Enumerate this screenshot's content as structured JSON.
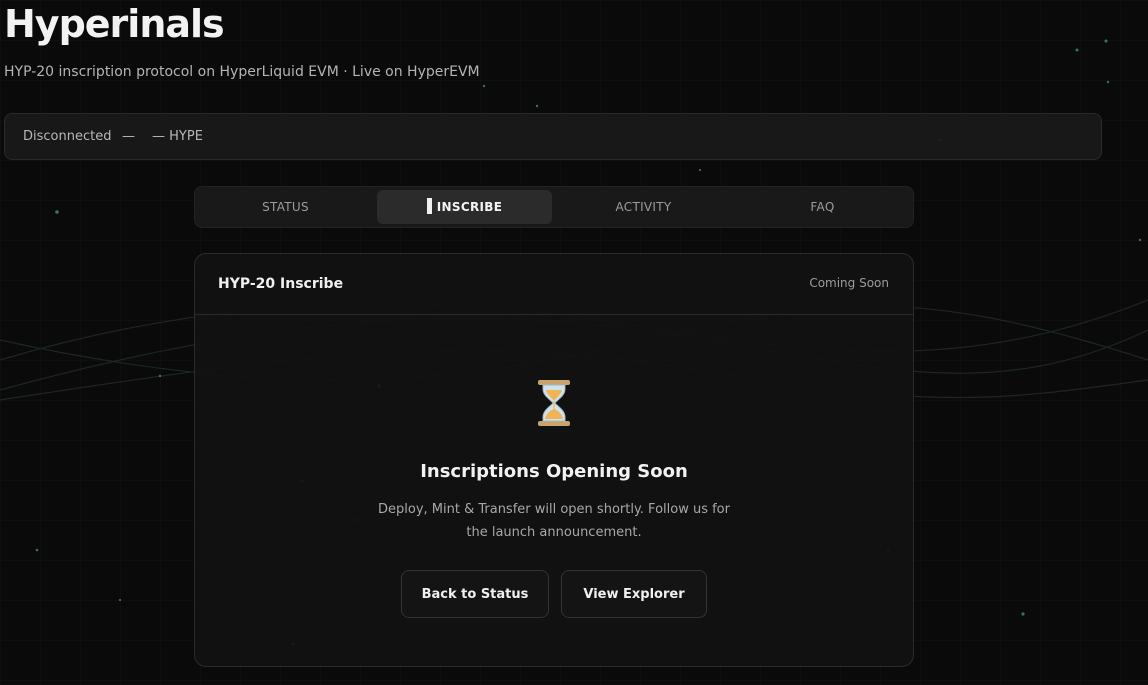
{
  "app": {
    "title": "Hyperinals",
    "subtitle": "HYP-20 inscription protocol on HyperLiquid EVM · Live on HyperEVM"
  },
  "wallet": {
    "status": "Disconnected",
    "address": "—",
    "balance": "— HYPE"
  },
  "tabs": [
    {
      "label": "STATUS",
      "active": false
    },
    {
      "label": "INSCRIBE",
      "active": true
    },
    {
      "label": "ACTIVITY",
      "active": false
    },
    {
      "label": "FAQ",
      "active": false
    }
  ],
  "panel": {
    "title": "HYP-20 Inscribe",
    "badge": "Coming Soon",
    "icon": "hourglass-icon",
    "heading": "Inscriptions Opening Soon",
    "description": "Deploy, Mint & Transfer will open shortly. Follow us for the launch announcement.",
    "buttons": {
      "back": "Back to Status",
      "explorer": "View Explorer"
    }
  },
  "colors": {
    "background": "#0a0a0a",
    "particle": "#3f8f78",
    "panel_border": "#2b2b2b"
  }
}
